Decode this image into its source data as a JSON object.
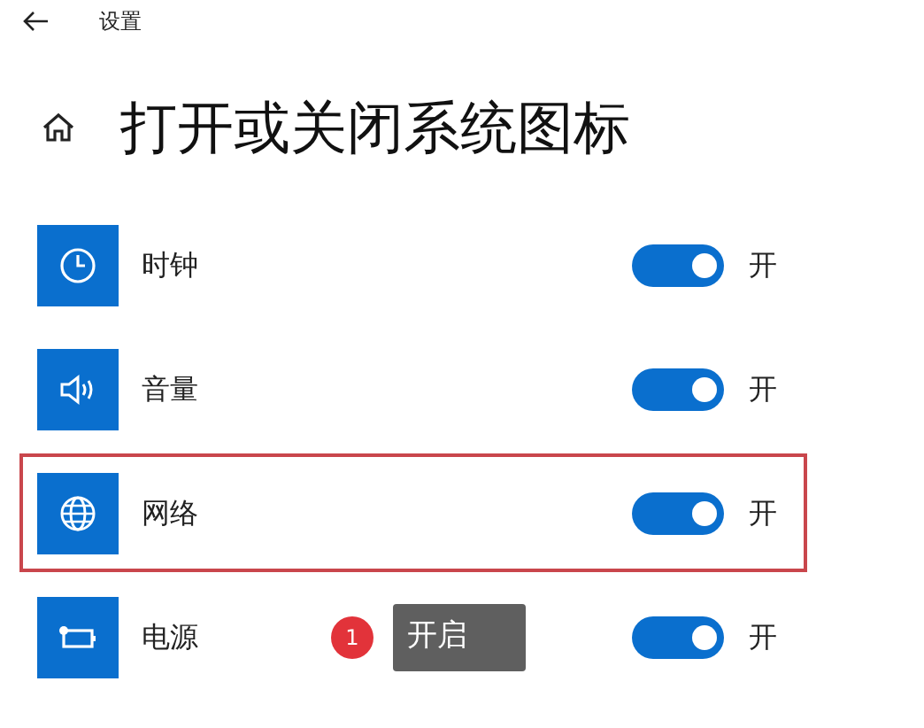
{
  "window": {
    "title": "设置"
  },
  "heading": "打开或关闭系统图标",
  "items": [
    {
      "kind": "clock",
      "label": "时钟",
      "on": true,
      "state": "开",
      "highlighted": false
    },
    {
      "kind": "volume",
      "label": "音量",
      "on": true,
      "state": "开",
      "highlighted": false
    },
    {
      "kind": "globe",
      "label": "网络",
      "on": true,
      "state": "开",
      "highlighted": true
    },
    {
      "kind": "battery",
      "label": "电源",
      "on": true,
      "state": "开",
      "highlighted": false
    }
  ],
  "callout": {
    "badge": "1",
    "text": "开启"
  }
}
